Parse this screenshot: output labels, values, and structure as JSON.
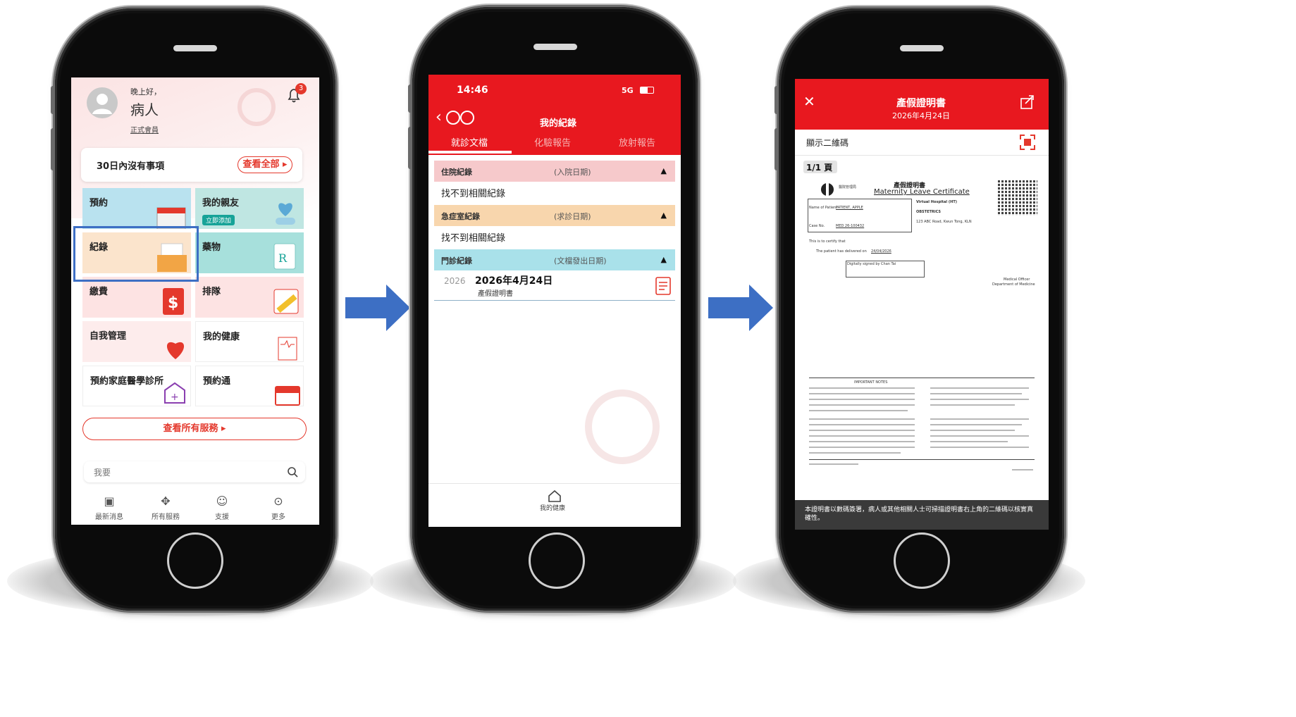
{
  "screen1": {
    "greeting": "晚上好，",
    "user_name": "病人",
    "member_label": "正式會員",
    "notification_count": "3",
    "upcoming_text": "30日內沒有事項",
    "view_all_label": "查看全部 ▸",
    "tiles": {
      "appointment": "預約",
      "family": "我的親友",
      "family_badge": "立即添加",
      "records": "紀錄",
      "medication": "藥物",
      "payment": "繳費",
      "queue": "排隊",
      "self_manage": "自我管理",
      "my_health": "我的健康",
      "family_clinic": "預約家庭醫學診所",
      "appointment_pass": "預約通"
    },
    "all_services_label": "查看所有服務 ▸",
    "search_placeholder": "我要",
    "nav": [
      "最新消息",
      "所有服務",
      "支援",
      "更多"
    ]
  },
  "screen2": {
    "time": "14:46",
    "signal": "5G",
    "title": "我的紀錄",
    "tabs": [
      "就診文檔",
      "化驗報告",
      "放射報告"
    ],
    "sections": [
      {
        "name": "住院紀錄",
        "date_label": "(入院日期)",
        "empty": "找不到相關紀錄",
        "color": "#f6c9cb"
      },
      {
        "name": "急症室紀錄",
        "date_label": "(求診日期)",
        "empty": "找不到相關紀錄",
        "color": "#f8d6ad"
      },
      {
        "name": "門診紀錄",
        "date_label": "(文檔發出日期)",
        "empty": "",
        "color": "#a9e1ea"
      }
    ],
    "record": {
      "year": "2026",
      "date": "2026年4月24日",
      "doc_name": "產假證明書"
    },
    "bottom_nav": "我的健康"
  },
  "screen3": {
    "title": "產假證明書",
    "date": "2026年4月24日",
    "show_qr": "顯示二維碼",
    "page_indicator": "1/1 頁",
    "cert_title_zh": "產假證明書",
    "cert_title_en": "Maternity Leave Certificate",
    "patient_name_label": "Name of Patient",
    "patient_name": "PATIENT, APPLE",
    "case_label": "Case No.",
    "case_no": "MED 26-100432",
    "hospital": "Virtual Hospital (HT)",
    "department": "OBSTETRICS",
    "address": "123 ABC Road, Kwun Tong, KLN",
    "certify_line": "This is to certify that",
    "delivery_line": "The patient has delivered on",
    "delivery_date": "24/04/2026",
    "signature_line": "Digitally signed by Chan Tai",
    "officer_line_1": "Medical Officer",
    "officer_line_2": "Department of Medicine",
    "notes_title": "IMPORTANT NOTES",
    "footer_note": "本證明書以數碼簽署，病人或其他相關人士可掃描證明書右上角的二維碼以核實真確性。"
  }
}
